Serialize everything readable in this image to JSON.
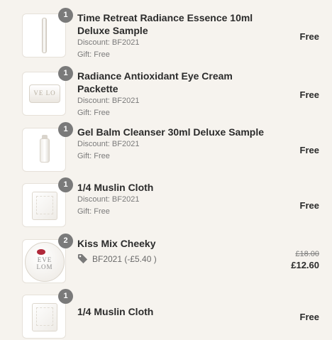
{
  "items": [
    {
      "quantity": "1",
      "name": "Time Retreat Radiance Essence 10ml Deluxe Sample",
      "discount": "Discount: BF2021",
      "gift": "Gift: Free",
      "price": "Free",
      "image_icon": "essence-vial-image"
    },
    {
      "quantity": "1",
      "name": "Radiance Antioxidant Eye Cream Packette",
      "discount": "Discount: BF2021",
      "gift": "Gift: Free",
      "price": "Free",
      "image_icon": "eye-cream-jar-image",
      "image_text": "VE LO"
    },
    {
      "quantity": "1",
      "name": "Gel Balm Cleanser 30ml Deluxe Sample",
      "discount": "Discount: BF2021",
      "gift": "Gift: Free",
      "price": "Free",
      "image_icon": "cleanser-tube-image"
    },
    {
      "quantity": "1",
      "name": "1/4 Muslin Cloth",
      "discount": "Discount: BF2021",
      "gift": "Gift: Free",
      "price": "Free",
      "image_icon": "muslin-cloth-image"
    },
    {
      "quantity": "2",
      "name": "Kiss Mix Cheeky",
      "discount_code": "BF2021 (-£5.40 )",
      "original_price": "£18.00",
      "price": "£12.60",
      "image_icon": "lip-balm-tin-image",
      "image_text": "EVE LOM"
    },
    {
      "quantity": "1",
      "name": "1/4 Muslin Cloth",
      "price": "Free",
      "image_icon": "muslin-cloth-image"
    }
  ],
  "colors": {
    "background": "#f6f3ee",
    "badge": "#7a7a7a",
    "text_primary": "#2b2b2b",
    "text_secondary": "#7a7a7a",
    "lipstick_red": "#b0283a"
  }
}
